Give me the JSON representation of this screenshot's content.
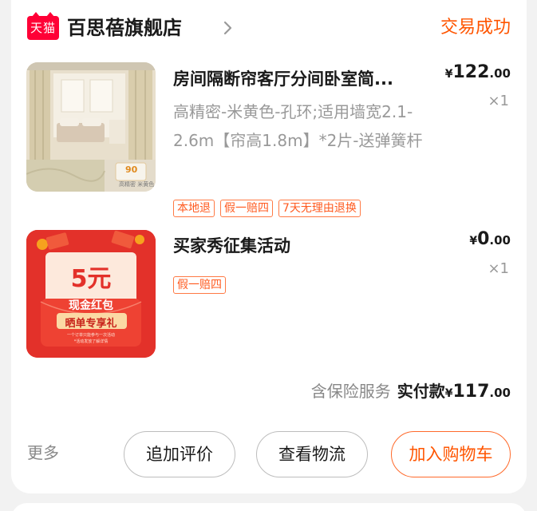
{
  "store": {
    "platform_badge": "天猫",
    "name": "百思蓓旗舰店",
    "order_status": "交易成功",
    "accent_color": "#ff5500"
  },
  "items": [
    {
      "title": "房间隔断帘客厅分间卧室简...",
      "spec": "高精密-米黄色-孔环;适用墙宽2.1-2.6m【帘高1.8m】*2片-送弹簧杆",
      "currency": "¥",
      "price_int": "122",
      "price_dec": ".00",
      "quantity": "×1",
      "tags": [
        "本地退",
        "假一赔四",
        "7天无理由退换"
      ],
      "thumb_badge": "90",
      "thumb_caption": "高精密 米黄色"
    },
    {
      "title": "买家秀征集活动",
      "currency": "¥",
      "price_int": "0",
      "price_dec": ".00",
      "quantity": "×1",
      "tags": [
        "假一赔四"
      ],
      "thumb": {
        "amount": "5元",
        "line1": "现金红包",
        "line2": "晒单专享礼",
        "fine1": "一个订单只能参与一次活动",
        "fine2": "*活动发放了解详情"
      }
    }
  ],
  "summary": {
    "insurance": "含保险服务",
    "paid_label": "实付款",
    "currency": "¥",
    "amount_int": "117",
    "amount_dec": ".00"
  },
  "actions": {
    "more": "更多",
    "review": "追加评价",
    "logistics": "查看物流",
    "cart": "加入购物车"
  }
}
